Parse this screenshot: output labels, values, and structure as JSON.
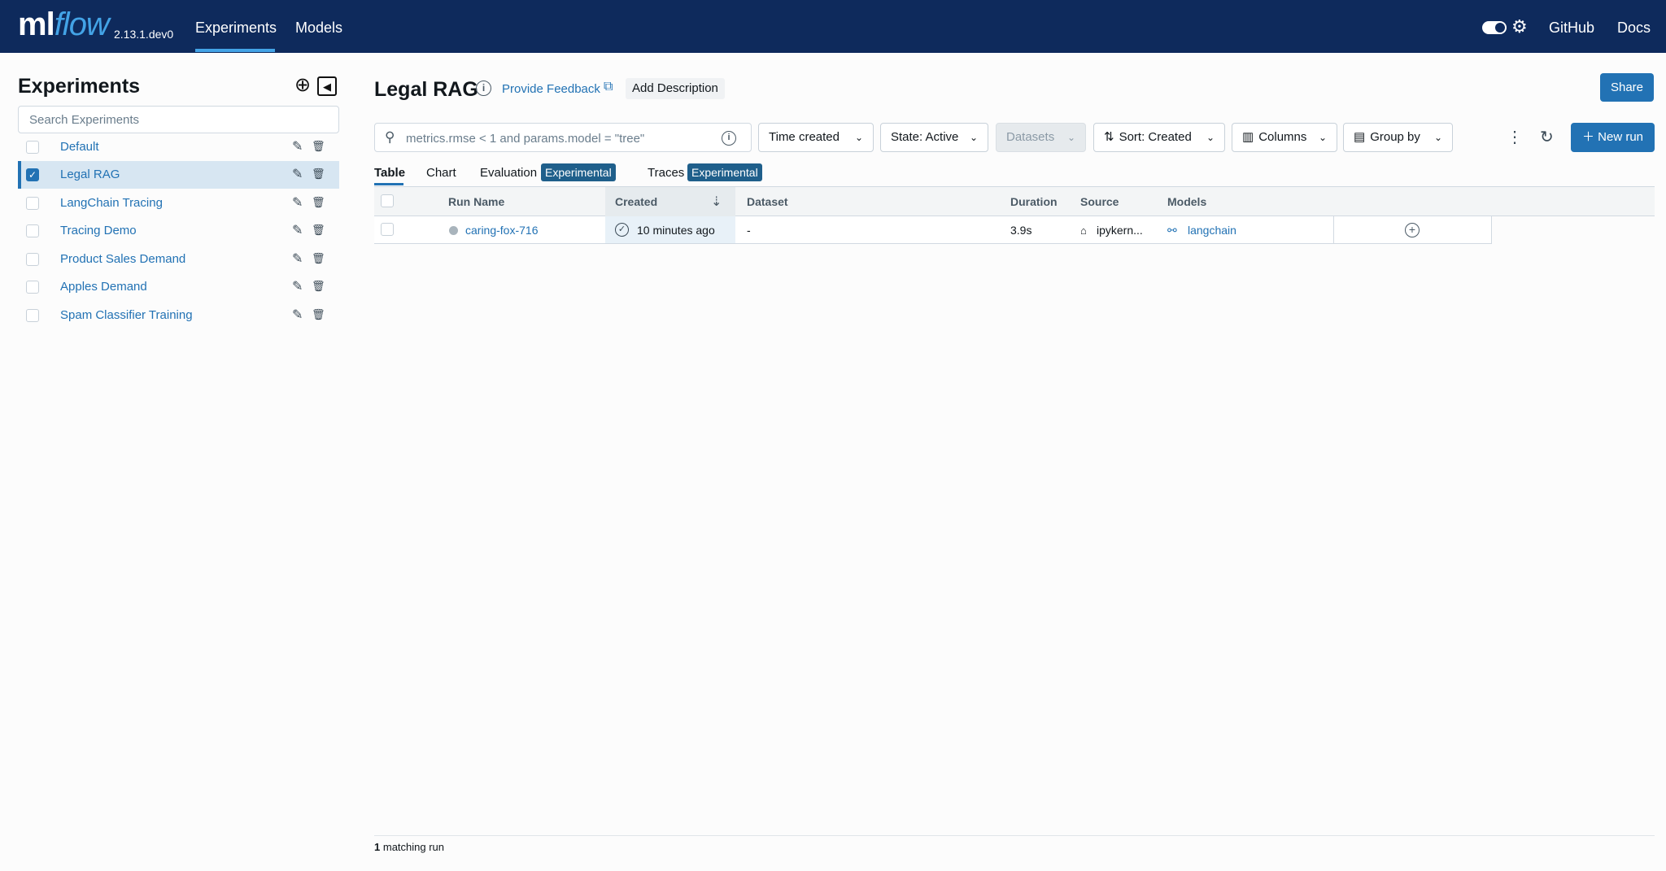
{
  "topbar": {
    "logo_ml": "ml",
    "logo_flow": "flow",
    "version": "2.13.1.dev0",
    "nav": [
      "Experiments",
      "Models"
    ],
    "right_links": [
      "GitHub",
      "Docs"
    ],
    "bg_color": "#0e2a5c",
    "accent_color": "#43a3e6"
  },
  "sidebar": {
    "title": "Experiments",
    "search_placeholder": "Search Experiments",
    "experiments": [
      {
        "name": "Default",
        "selected": false
      },
      {
        "name": "Legal RAG",
        "selected": true
      },
      {
        "name": "LangChain Tracing",
        "selected": false
      },
      {
        "name": "Tracing Demo",
        "selected": false
      },
      {
        "name": "Product Sales Demand",
        "selected": false
      },
      {
        "name": "Apples Demand",
        "selected": false
      },
      {
        "name": "Spam Classifier Training",
        "selected": false
      }
    ]
  },
  "header": {
    "title": "Legal RAG",
    "feedback": "Provide Feedback",
    "add_description": "Add Description",
    "share": "Share"
  },
  "toolbar": {
    "search_text": "metrics.rmse < 1 and params.model = \"tree\"",
    "time_created": "Time created",
    "state": "State: Active",
    "datasets": "Datasets",
    "sort": "Sort: Created",
    "columns": "Columns",
    "group_by": "Group by",
    "new_run": "New run"
  },
  "tabs": {
    "table": "Table",
    "chart": "Chart",
    "evaluation": "Evaluation",
    "traces": "Traces",
    "badge": "Experimental"
  },
  "table": {
    "headers": [
      "Run Name",
      "Created",
      "Dataset",
      "Duration",
      "Source",
      "Models"
    ],
    "rows": [
      {
        "run_name": "caring-fox-716",
        "created": "10 minutes ago",
        "dataset": "-",
        "duration": "3.9s",
        "source": "ipykern...",
        "models": "langchain"
      }
    ]
  },
  "footer": {
    "count": "1",
    "label": "matching run"
  }
}
